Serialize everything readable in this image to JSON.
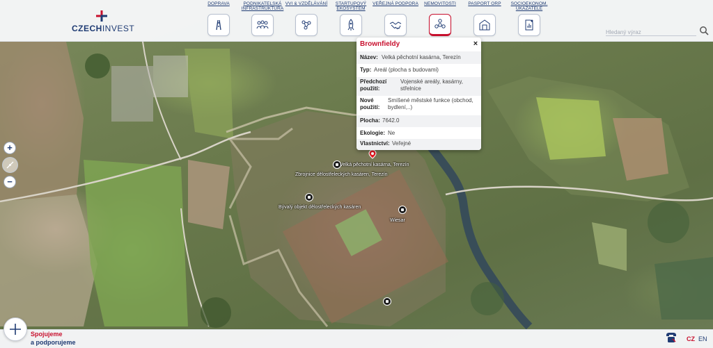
{
  "brand": {
    "logo_text_a": "CZECH",
    "logo_text_b": "INVEST",
    "accent": "#c8102e",
    "primary": "#1f3b73"
  },
  "nav": [
    {
      "label": "DOPRAVA",
      "icon": "road-icon"
    },
    {
      "label": "PODNIKATELSKÁ INFRASTRUKTURA",
      "icon": "handshake-group-icon"
    },
    {
      "label": "VVI & VZDĚLÁVÁNÍ",
      "icon": "atom-icon"
    },
    {
      "label": "STARTUPOVÝ EKOSYSTÉM",
      "icon": "rocket-icon"
    },
    {
      "label": "VEŘEJNÁ PODPORA",
      "icon": "handshake-icon"
    },
    {
      "label": "NEMOVITOSTI",
      "icon": "network-icon",
      "active": true
    },
    {
      "label": "PASPORT ORP",
      "icon": "building-icon"
    },
    {
      "label": "SOCIOEKONOM. UKAZATELE",
      "icon": "document-chart-icon"
    }
  ],
  "search": {
    "placeholder": "Hledaný výraz"
  },
  "zoom": {
    "in": "+",
    "out": "−"
  },
  "popup": {
    "title": "Brownfieldy",
    "close": "×",
    "rows": [
      {
        "key": "Název:",
        "value": "Velká pěchotní kasárna, Terezín"
      },
      {
        "key": "Typ:",
        "value": "Areál (plocha s budovami)"
      },
      {
        "key": "Předchozí použití:",
        "value": "Vojenské areály, kasárny, střelnice"
      },
      {
        "key": "Nové použití:",
        "value": "Smíšené městské funkce (obchod, bydlení,..)"
      },
      {
        "key": "Plocha:",
        "value": "7642.0"
      },
      {
        "key": "Ekologie:",
        "value": "Ne"
      },
      {
        "key": "Vlastnictví:",
        "value": "Veřejné"
      }
    ]
  },
  "map_labels": [
    "Velká pěchotní kasárna, Terezín",
    "Zbrojnice dělostřeleckých kasáren, Terezín",
    "Bývalý objekt dělostřeleckých kasáren",
    "Wiesar"
  ],
  "footer": {
    "slogan_line1": "Spojujeme",
    "slogan_line2": "a podporujeme",
    "lang_cz": "CZ",
    "lang_en": "EN"
  }
}
